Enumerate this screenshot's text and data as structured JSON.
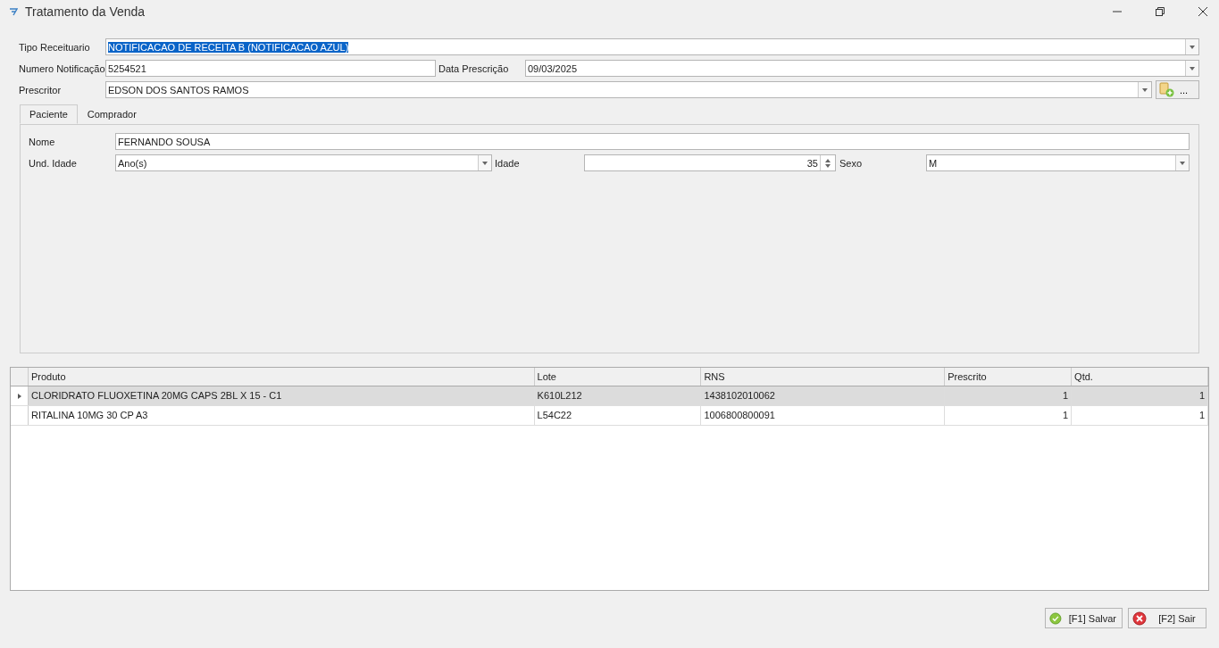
{
  "window": {
    "title": "Tratamento da Venda"
  },
  "form": {
    "tipo_receituario": {
      "label": "Tipo Receituario",
      "value": "NOTIFICACAO DE RECEITA B (NOTIFICACAO AZUL)",
      "text_selected": true
    },
    "numero_notificacao": {
      "label": "Numero Notificação",
      "value": "5254521"
    },
    "data_prescricao": {
      "label": "Data Prescrição",
      "value": "09/03/2025"
    },
    "prescritor": {
      "label": "Prescritor",
      "value": "EDSON DOS SANTOS RAMOS",
      "extra_button": "..."
    }
  },
  "tabs": [
    {
      "label": "Paciente",
      "selected": true
    },
    {
      "label": "Comprador",
      "selected": false
    }
  ],
  "paciente": {
    "nome": {
      "label": "Nome",
      "value": "FERNANDO SOUSA"
    },
    "und_idade": {
      "label": "Und. Idade",
      "value": "Ano(s)"
    },
    "idade": {
      "label": "Idade",
      "value": "35"
    },
    "sexo": {
      "label": "Sexo",
      "value": "M"
    }
  },
  "table": {
    "columns": [
      "Produto",
      "Lote",
      "RNS",
      "Prescrito",
      "Qtd."
    ],
    "rows": [
      {
        "selected": true,
        "cells": [
          "CLORIDRATO FLUOXETINA 20MG CAPS 2BL X 15 - C1",
          "K610L212",
          "1438102010062",
          "1",
          "1"
        ]
      },
      {
        "selected": false,
        "cells": [
          "RITALINA 10MG 30 CP A3",
          "L54C22",
          "1006800800091",
          "1",
          "1"
        ]
      }
    ]
  },
  "buttons": [
    {
      "kind": "save",
      "label": "[F1] Salvar"
    },
    {
      "kind": "exit",
      "label": "[F2] Sair"
    }
  ]
}
